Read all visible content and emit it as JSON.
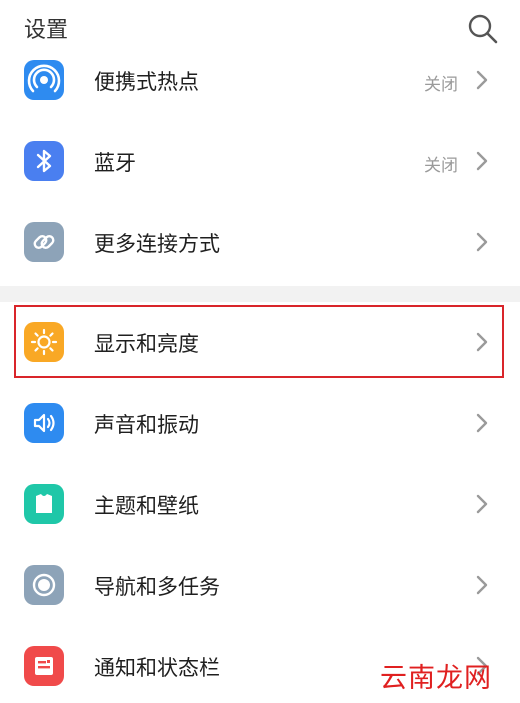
{
  "header": {
    "title": "设置"
  },
  "icons": {
    "search": "search-icon",
    "chevron": "chevron-right-icon"
  },
  "rows": [
    {
      "id": "hotspot",
      "label": "便携式热点",
      "status": "关闭",
      "icon": "hotspot-icon",
      "color": "#2e8bf0"
    },
    {
      "id": "bluetooth",
      "label": "蓝牙",
      "status": "关闭",
      "icon": "bluetooth-icon",
      "color": "#4a7ff0"
    },
    {
      "id": "more-connections",
      "label": "更多连接方式",
      "status": "",
      "icon": "link-icon",
      "color": "#8da3b8"
    },
    {
      "id": "display",
      "label": "显示和亮度",
      "status": "",
      "icon": "sun-icon",
      "color": "#f9a825",
      "highlighted": true
    },
    {
      "id": "sound",
      "label": "声音和振动",
      "status": "",
      "icon": "speaker-icon",
      "color": "#2e8bf0"
    },
    {
      "id": "themes",
      "label": "主题和壁纸",
      "status": "",
      "icon": "shirt-icon",
      "color": "#1fc7a8"
    },
    {
      "id": "navigation",
      "label": "导航和多任务",
      "status": "",
      "icon": "circle-icon",
      "color": "#8da3b8"
    },
    {
      "id": "notifications",
      "label": "通知和状态栏",
      "status": "",
      "icon": "notification-icon",
      "color": "#f04a4a"
    }
  ],
  "highlight_color": "#d9252a",
  "watermark": "云南龙网"
}
